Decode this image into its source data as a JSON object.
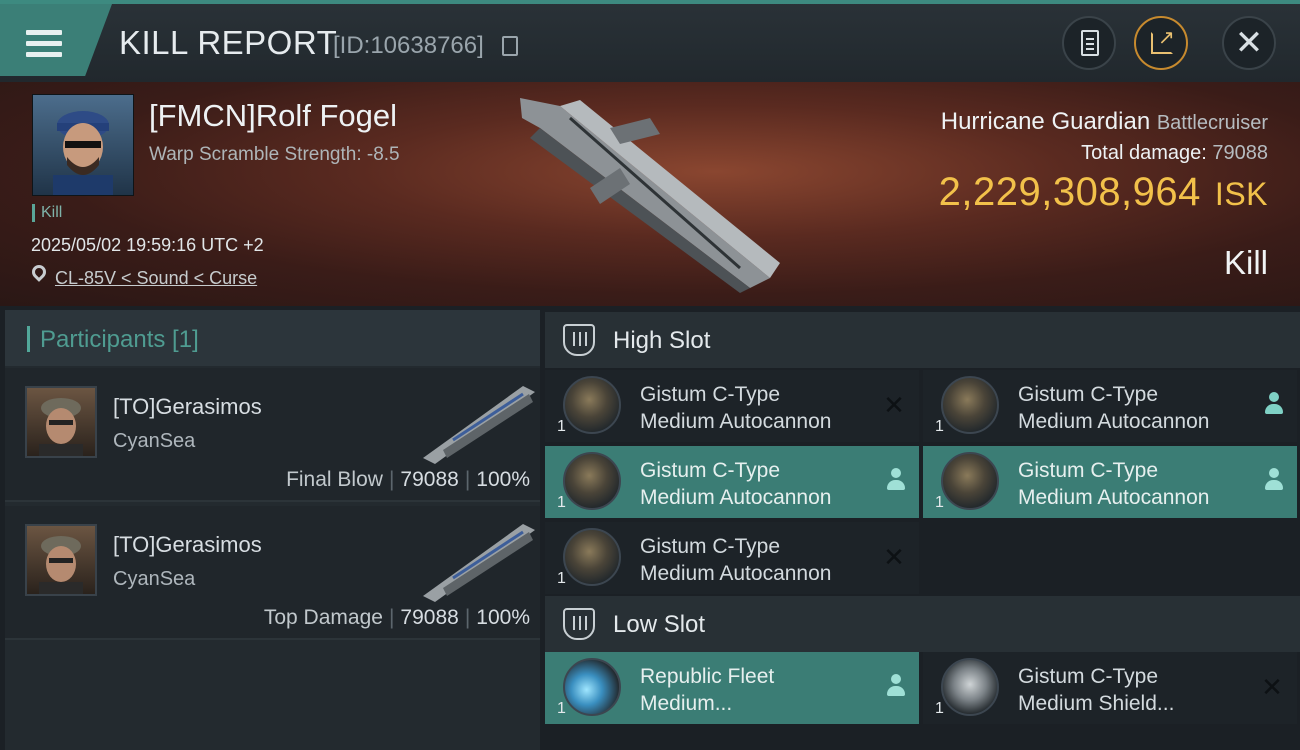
{
  "header": {
    "title": "KILL REPORT",
    "kill_id": "[ID:10638766]"
  },
  "victim": {
    "name": "[FMCN]Rolf Fogel",
    "scramble": "Warp Scramble Strength: -8.5",
    "tag": "Kill",
    "datetime": "2025/05/02 19:59:16 UTC +2",
    "location": "CL-85V < Sound < Curse",
    "ship_name": "Hurricane Guardian",
    "ship_class": "Battlecruiser",
    "total_damage_label": "Total damage:",
    "total_damage": "79088",
    "isk_value": "2,229,308,964",
    "isk_unit": "ISK",
    "result": "Kill"
  },
  "participants": {
    "title": "Participants [1]",
    "rows": [
      {
        "name": "[TO]Gerasimos",
        "corp": "CyanSea",
        "role": "Final Blow",
        "damage": "79088",
        "percent": "100%"
      },
      {
        "name": "[TO]Gerasimos",
        "corp": "CyanSea",
        "role": "Top Damage",
        "damage": "79088",
        "percent": "100%"
      }
    ]
  },
  "high_slot": {
    "title": "High Slot",
    "modules": [
      {
        "line1": "Gistum C-Type",
        "line2": "Medium Autocannon",
        "qty": "1",
        "status": "destroyed"
      },
      {
        "line1": "Gistum C-Type",
        "line2": "Medium Autocannon",
        "qty": "1",
        "status": "dropped"
      },
      {
        "line1": "Gistum C-Type",
        "line2": "Medium Autocannon",
        "qty": "1",
        "status": "dropped"
      },
      {
        "line1": "Gistum C-Type",
        "line2": "Medium Autocannon",
        "qty": "1",
        "status": "dropped"
      },
      {
        "line1": "Gistum C-Type",
        "line2": "Medium Autocannon",
        "qty": "1",
        "status": "destroyed"
      }
    ]
  },
  "low_slot": {
    "title": "Low Slot",
    "modules": [
      {
        "line1": "Republic Fleet",
        "line2": "Medium...",
        "qty": "1",
        "status": "dropped"
      },
      {
        "line1": "Gistum C-Type",
        "line2": "Medium Shield...",
        "qty": "1",
        "status": "destroyed"
      }
    ]
  },
  "colors": {
    "accent": "#3b7f77",
    "isk": "#f2c14a",
    "banner": "#5a2a20"
  },
  "icons": {
    "menu": "hamburger-icon",
    "copy": "copy-icon",
    "clipboard": "clipboard-icon",
    "share": "share-icon",
    "close": "close-icon",
    "location": "pin-icon",
    "slot": "slot-icon",
    "destroyed": "x-icon",
    "dropped": "person-icon"
  }
}
